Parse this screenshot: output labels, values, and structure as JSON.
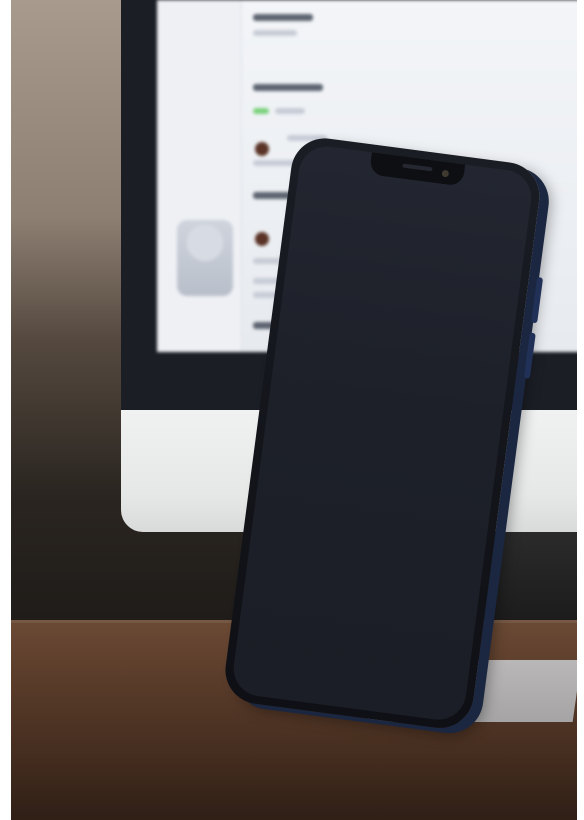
{
  "scene": {
    "subject": "smartphone-leaning-against-monitor",
    "colors": {
      "phone_body": "#12141a",
      "phone_frame": "#1b2640",
      "monitor_screen": "#eceff3",
      "monitor_chin": "#e6e7e7",
      "desk_wood": "#5a3c2a",
      "wall": "#8d7f72"
    },
    "icons": [
      "phone-camera-icon",
      "phone-speaker-icon"
    ]
  }
}
